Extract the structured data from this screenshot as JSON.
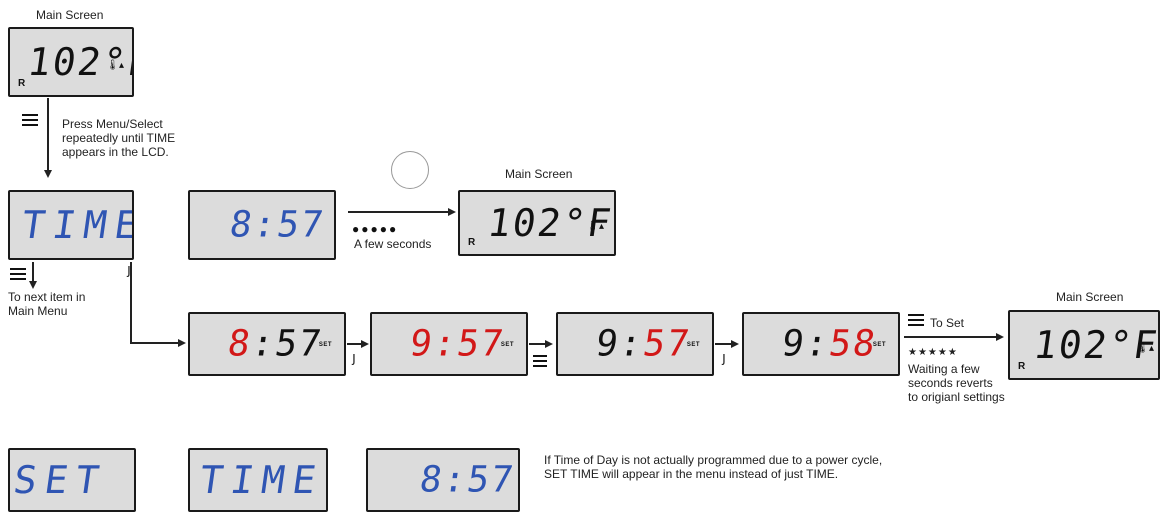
{
  "labels": {
    "main_screen": "Main Screen",
    "press_menu": "Press Menu/Select\nrepeatedly until TIME\nappears in the LCD.",
    "few_seconds": "A few seconds",
    "next_item": "To next item in\nMain Menu",
    "to_set": "To Set",
    "waiting": "Waiting a few\nseconds reverts\nto origianl settings",
    "stars_5": "★★★★★",
    "dots_5": "●●●●●",
    "note": "If Time of Day is not actually programmed due to a power cycle,\nSET TIME will appear in the menu instead of just TIME."
  },
  "displays": {
    "temp": "102°F",
    "time_word": "TIME",
    "set_word": "SET",
    "clock": "8:57",
    "step1_hour": "8",
    "step1_min": ":57",
    "step2_hour": "9",
    "step2_min": ":57",
    "step3_hour": "9:",
    "step3_min": "57",
    "step4_hour": "9:",
    "step4_min": "58",
    "set_tag": "SET",
    "r_indicator": "R"
  },
  "colors": {
    "lcd_bg": "#dcdcdc",
    "digit_black": "#111111",
    "digit_blue": "#2f55b3",
    "digit_red": "#d21818"
  },
  "icons": [
    "menu-icon",
    "light-hook-icon",
    "thermometer-icon",
    "arrow-icon"
  ]
}
